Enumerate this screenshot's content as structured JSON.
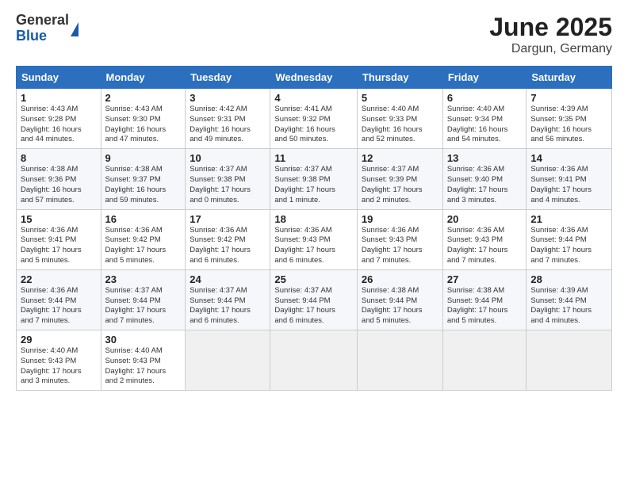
{
  "logo": {
    "line1": "General",
    "line2": "Blue"
  },
  "title": "June 2025",
  "subtitle": "Dargun, Germany",
  "days_of_week": [
    "Sunday",
    "Monday",
    "Tuesday",
    "Wednesday",
    "Thursday",
    "Friday",
    "Saturday"
  ],
  "weeks": [
    [
      {
        "day": "1",
        "text": "Sunrise: 4:43 AM\nSunset: 9:28 PM\nDaylight: 16 hours\nand 44 minutes."
      },
      {
        "day": "2",
        "text": "Sunrise: 4:43 AM\nSunset: 9:30 PM\nDaylight: 16 hours\nand 47 minutes."
      },
      {
        "day": "3",
        "text": "Sunrise: 4:42 AM\nSunset: 9:31 PM\nDaylight: 16 hours\nand 49 minutes."
      },
      {
        "day": "4",
        "text": "Sunrise: 4:41 AM\nSunset: 9:32 PM\nDaylight: 16 hours\nand 50 minutes."
      },
      {
        "day": "5",
        "text": "Sunrise: 4:40 AM\nSunset: 9:33 PM\nDaylight: 16 hours\nand 52 minutes."
      },
      {
        "day": "6",
        "text": "Sunrise: 4:40 AM\nSunset: 9:34 PM\nDaylight: 16 hours\nand 54 minutes."
      },
      {
        "day": "7",
        "text": "Sunrise: 4:39 AM\nSunset: 9:35 PM\nDaylight: 16 hours\nand 56 minutes."
      }
    ],
    [
      {
        "day": "8",
        "text": "Sunrise: 4:38 AM\nSunset: 9:36 PM\nDaylight: 16 hours\nand 57 minutes."
      },
      {
        "day": "9",
        "text": "Sunrise: 4:38 AM\nSunset: 9:37 PM\nDaylight: 16 hours\nand 59 minutes."
      },
      {
        "day": "10",
        "text": "Sunrise: 4:37 AM\nSunset: 9:38 PM\nDaylight: 17 hours\nand 0 minutes."
      },
      {
        "day": "11",
        "text": "Sunrise: 4:37 AM\nSunset: 9:38 PM\nDaylight: 17 hours\nand 1 minute."
      },
      {
        "day": "12",
        "text": "Sunrise: 4:37 AM\nSunset: 9:39 PM\nDaylight: 17 hours\nand 2 minutes."
      },
      {
        "day": "13",
        "text": "Sunrise: 4:36 AM\nSunset: 9:40 PM\nDaylight: 17 hours\nand 3 minutes."
      },
      {
        "day": "14",
        "text": "Sunrise: 4:36 AM\nSunset: 9:41 PM\nDaylight: 17 hours\nand 4 minutes."
      }
    ],
    [
      {
        "day": "15",
        "text": "Sunrise: 4:36 AM\nSunset: 9:41 PM\nDaylight: 17 hours\nand 5 minutes."
      },
      {
        "day": "16",
        "text": "Sunrise: 4:36 AM\nSunset: 9:42 PM\nDaylight: 17 hours\nand 5 minutes."
      },
      {
        "day": "17",
        "text": "Sunrise: 4:36 AM\nSunset: 9:42 PM\nDaylight: 17 hours\nand 6 minutes."
      },
      {
        "day": "18",
        "text": "Sunrise: 4:36 AM\nSunset: 9:43 PM\nDaylight: 17 hours\nand 6 minutes."
      },
      {
        "day": "19",
        "text": "Sunrise: 4:36 AM\nSunset: 9:43 PM\nDaylight: 17 hours\nand 7 minutes."
      },
      {
        "day": "20",
        "text": "Sunrise: 4:36 AM\nSunset: 9:43 PM\nDaylight: 17 hours\nand 7 minutes."
      },
      {
        "day": "21",
        "text": "Sunrise: 4:36 AM\nSunset: 9:44 PM\nDaylight: 17 hours\nand 7 minutes."
      }
    ],
    [
      {
        "day": "22",
        "text": "Sunrise: 4:36 AM\nSunset: 9:44 PM\nDaylight: 17 hours\nand 7 minutes."
      },
      {
        "day": "23",
        "text": "Sunrise: 4:37 AM\nSunset: 9:44 PM\nDaylight: 17 hours\nand 7 minutes."
      },
      {
        "day": "24",
        "text": "Sunrise: 4:37 AM\nSunset: 9:44 PM\nDaylight: 17 hours\nand 6 minutes."
      },
      {
        "day": "25",
        "text": "Sunrise: 4:37 AM\nSunset: 9:44 PM\nDaylight: 17 hours\nand 6 minutes."
      },
      {
        "day": "26",
        "text": "Sunrise: 4:38 AM\nSunset: 9:44 PM\nDaylight: 17 hours\nand 5 minutes."
      },
      {
        "day": "27",
        "text": "Sunrise: 4:38 AM\nSunset: 9:44 PM\nDaylight: 17 hours\nand 5 minutes."
      },
      {
        "day": "28",
        "text": "Sunrise: 4:39 AM\nSunset: 9:44 PM\nDaylight: 17 hours\nand 4 minutes."
      }
    ],
    [
      {
        "day": "29",
        "text": "Sunrise: 4:40 AM\nSunset: 9:43 PM\nDaylight: 17 hours\nand 3 minutes."
      },
      {
        "day": "30",
        "text": "Sunrise: 4:40 AM\nSunset: 9:43 PM\nDaylight: 17 hours\nand 2 minutes."
      },
      {
        "day": "",
        "text": ""
      },
      {
        "day": "",
        "text": ""
      },
      {
        "day": "",
        "text": ""
      },
      {
        "day": "",
        "text": ""
      },
      {
        "day": "",
        "text": ""
      }
    ]
  ]
}
